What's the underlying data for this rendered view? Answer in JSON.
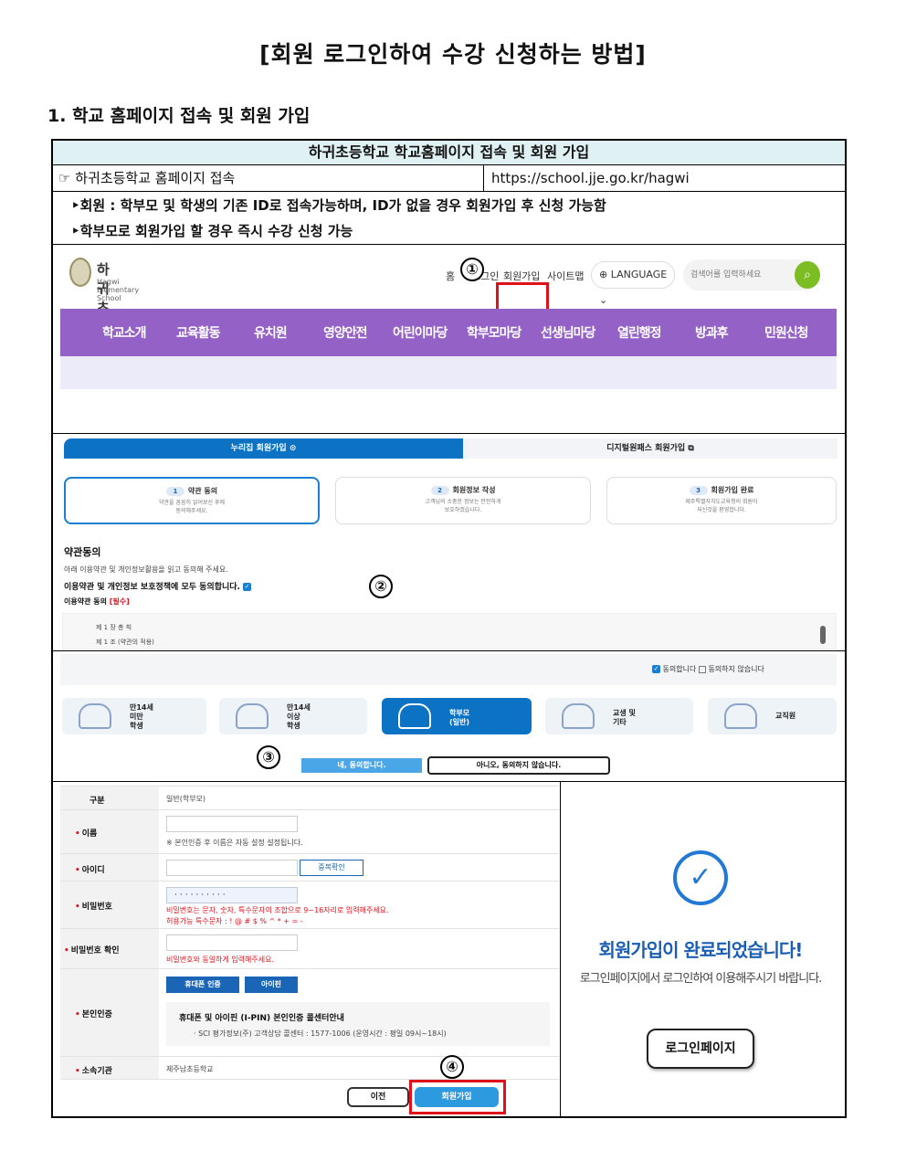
{
  "title": "[회원 로그인하여 수강 신청하는 방법]",
  "section1": "1. 학교 홈페이지 접속 및 회원 가입",
  "table": {
    "header": "하귀초등학교 학교홈페이지 접속 및 회원 가입",
    "row_label": "☞ 하귀초등학교 홈페이지 접속",
    "row_url": "https://school.jje.go.kr/hagwi",
    "note1": "‣회원 : 학부모 및 학생의 기존 ID로 접속가능하며, ID가 없을 경우 회원가입 후 신청 가능함",
    "note2": "‣학부모로 회원가입 할 경우 즉시 수강 신청 가능"
  },
  "homepage": {
    "school_name": "하귀초등학교",
    "school_name_en": "Hagwi Elementary School",
    "topnav": [
      "홈",
      "로그인",
      "회원가입",
      "사이트맵"
    ],
    "language": "LANGUAGE",
    "search_placeholder": "검색어를 입력하세요",
    "menu": [
      "학교소개",
      "교육활동",
      "유치원",
      "영양안전",
      "어린이마당",
      "학부모마당",
      "선생님마당",
      "열린행정",
      "방과후",
      "민원신청"
    ]
  },
  "markers": [
    "①",
    "②",
    "③",
    "④"
  ],
  "signup": {
    "tab_a": "누리집 회원가입",
    "tab_b": "디지털원패스 회원가입",
    "steps": [
      {
        "num": "1",
        "title": "약관 동의",
        "desc1": "약관을 꼼꼼히 읽어보신 후에",
        "desc2": "동의해주세요."
      },
      {
        "num": "2",
        "title": "회원정보 작성",
        "desc1": "고객님의 소중한 정보는 안전하게",
        "desc2": "보호하겠습니다."
      },
      {
        "num": "3",
        "title": "회원가입 완료",
        "desc1": "제주특별자치도교육청의 회원이",
        "desc2": "되신것을 환영합니다."
      }
    ],
    "agree_heading": "약관동의",
    "agree_sub": "아래 이용약관 및 개인정보활용을 읽고 동의해 주세요.",
    "agree_all": "이용약관 및 개인정보 보호정책에 모두 동의합니다.",
    "agree_req": "이용약관 동의",
    "agree_req_tag": "[필수]",
    "terms1": "제 1 장 총 칙",
    "terms2": "제 1 조 (약관의 적용)",
    "agree_yes_label": "동의합니다",
    "agree_no_label": "동의하지 않습니다",
    "user_types": [
      {
        "l1": "만14세",
        "l2": "미만",
        "l3": "학생"
      },
      {
        "l1": "만14세",
        "l2": "이상",
        "l3": "학생"
      },
      {
        "l1": "학부모",
        "l2": "(일반)",
        "l3": ""
      },
      {
        "l1": "교생 및",
        "l2": "기타",
        "l3": ""
      },
      {
        "l1": "교직원",
        "l2": "",
        "l3": ""
      }
    ],
    "btn_yes": "네, 동의합니다.",
    "btn_no": "아니오, 동의하지 않습니다."
  },
  "form": {
    "type_label": "구분",
    "type_value": "일반(학부모)",
    "name_label": "이름",
    "name_hint": "※ 본인인증 후 이름은 자동 설정 설정됩니다.",
    "id_label": "아이디",
    "dup_btn": "중복확인",
    "pw_label": "비밀번호",
    "pw_value": "··········",
    "pw_hint1": "비밀번호는 문자, 숫자, 특수문자의 조합으로 9~16자리로 입력해주세요.",
    "pw_hint2": "허용가능 특수문자 : ! @ # $ % ^ * + = -",
    "pw2_label": "비밀번호 확인",
    "pw2_hint": "비밀번호와 동일하게 입력해주세요.",
    "auth_label": "본인인증",
    "auth_phone": "휴대폰 인증",
    "auth_ipin": "아이핀",
    "auth_info": "휴대폰 및 아이핀 (I-PIN) 본인인증 콜센터안내",
    "auth_detail": "· SCI 평가정보(주) 고객상담 콜센터 : 1577-1006 (운영시간 : 평일 09시~18시)",
    "org_label": "소속기관",
    "org_value": "제주남초등학교",
    "btn_prev": "이전",
    "btn_join": "회원가입"
  },
  "complete": {
    "check": "✓",
    "title": "회원가입이 완료되었습니다!",
    "sub": "로그인페이지에서 로그인하여 이용해주시기 바랍니다.",
    "button": "로그인페이지"
  }
}
